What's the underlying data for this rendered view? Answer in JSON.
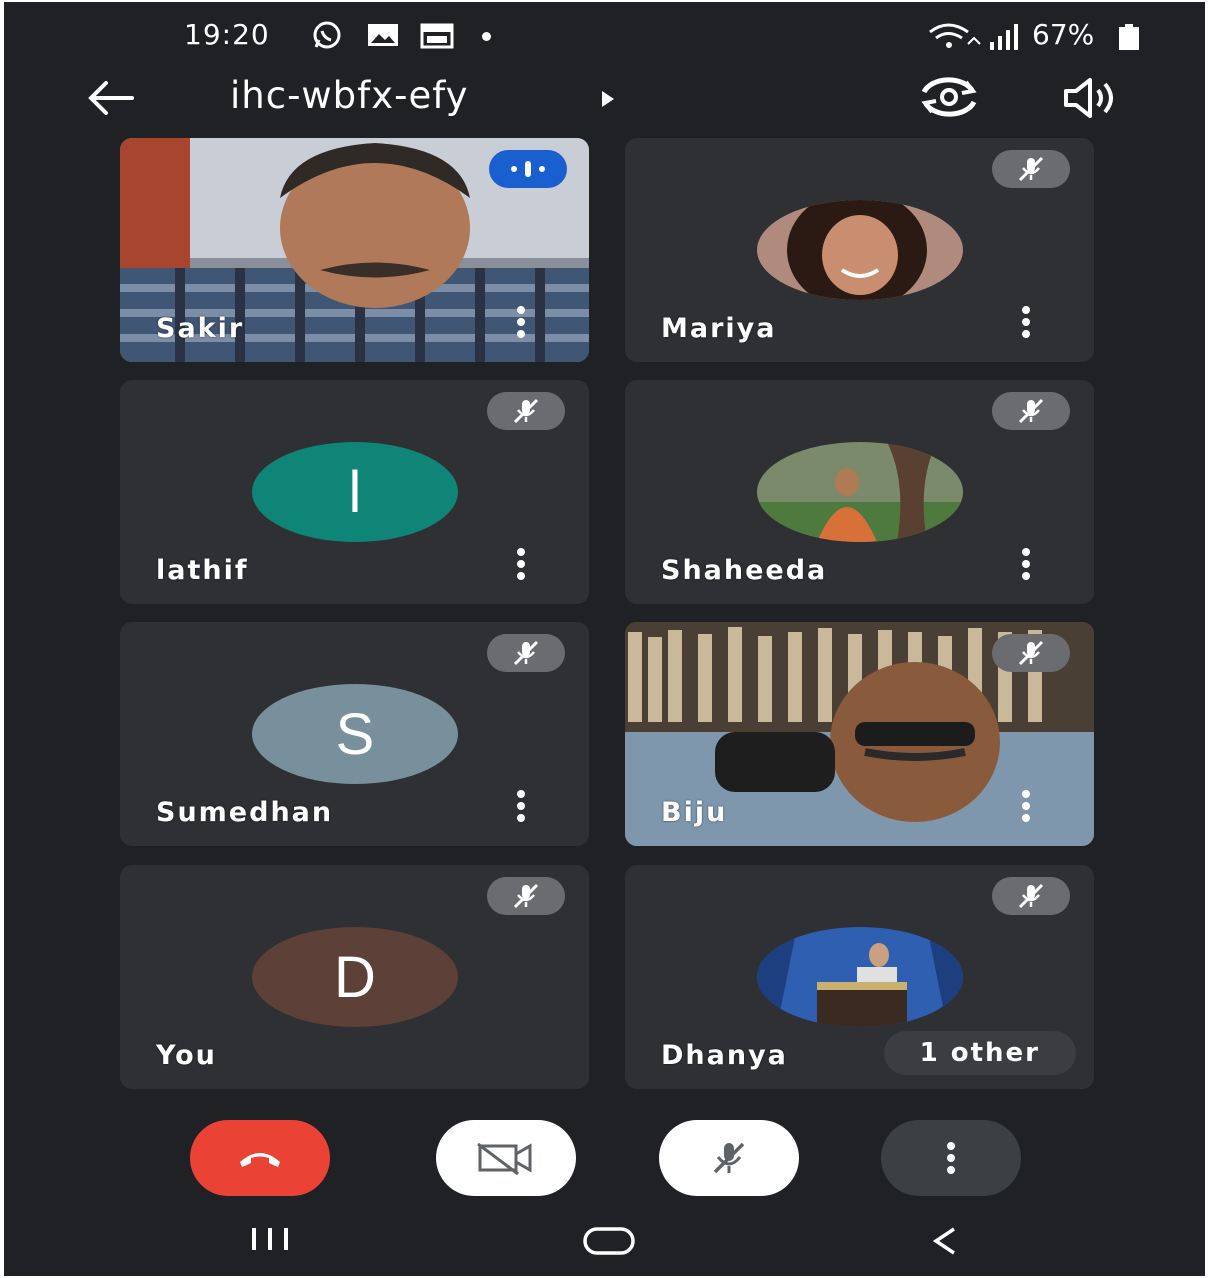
{
  "status_bar": {
    "time": "19:20",
    "battery": "67%"
  },
  "app_bar": {
    "meeting_code": "ihc-wbfx-efy"
  },
  "participants": [
    {
      "name": "Sakir",
      "state": "video",
      "speaking": true
    },
    {
      "name": "Mariya",
      "state": "photo",
      "muted": true
    },
    {
      "name": "lathif",
      "state": "initial",
      "initial": "l",
      "avatar_color": "#0f8577",
      "muted": true
    },
    {
      "name": "Shaheeda",
      "state": "photo",
      "muted": true
    },
    {
      "name": "Sumedhan",
      "state": "initial",
      "initial": "S",
      "avatar_color": "#78909c",
      "muted": true
    },
    {
      "name": "Biju",
      "state": "video",
      "muted": true
    },
    {
      "name": "You",
      "state": "initial",
      "initial": "D",
      "avatar_color": "#5d4037",
      "muted": true
    },
    {
      "name": "Dhanya",
      "state": "photo",
      "muted": true
    }
  ],
  "others_chip": "1 other",
  "controls": [
    "end-call",
    "camera-off",
    "mic-off",
    "more-options"
  ],
  "colors": {
    "background": "#202124",
    "tile": "#2f3033",
    "end_call": "#ea4335",
    "speaking_badge": "#1a5fd0",
    "mute_badge": "#6b6c70"
  }
}
